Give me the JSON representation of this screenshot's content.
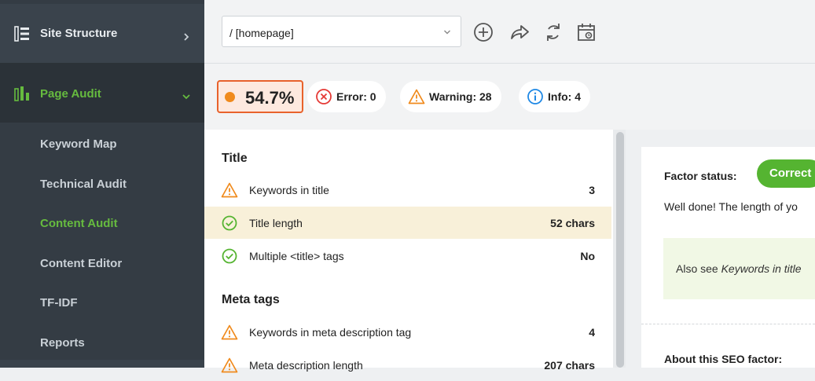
{
  "sidebar": {
    "site_structure": "Site Structure",
    "page_audit": "Page Audit",
    "items": [
      {
        "label": "Keyword Map"
      },
      {
        "label": "Technical Audit"
      },
      {
        "label": "Content Audit",
        "active": true
      },
      {
        "label": "Content Editor"
      },
      {
        "label": "TF-IDF"
      },
      {
        "label": "Reports"
      }
    ]
  },
  "toolbar": {
    "url_value": "/ [homepage]",
    "icons": [
      "add-circle-icon",
      "share-icon",
      "refresh-icon",
      "calendar-schedule-icon"
    ]
  },
  "status": {
    "score": "54.7%",
    "error": "Error: 0",
    "warning": "Warning: 28",
    "info": "Info: 4"
  },
  "factors": {
    "title_section": "Title",
    "meta_section": "Meta tags",
    "rows": [
      {
        "label": "Keywords in title",
        "value": "3",
        "status": "warning"
      },
      {
        "label": "Title length",
        "value": "52 chars",
        "status": "correct",
        "selected": true
      },
      {
        "label": "Multiple <title> tags",
        "value": "No",
        "status": "correct"
      },
      {
        "label": "Keywords in meta description tag",
        "value": "4",
        "status": "warning"
      },
      {
        "label": "Meta description length",
        "value": "207 chars",
        "status": "warning"
      }
    ]
  },
  "detail": {
    "factor_status_label": "Factor status:",
    "status_badge": "Correct",
    "message": "Well done! The length of yo",
    "see_also_prefix": "Also see ",
    "see_also_link": "Keywords in title",
    "about_label": "About this SEO factor:"
  },
  "colors": {
    "accent_green": "#66bb3f",
    "score_orange": "#e8622c",
    "error_red": "#e53935",
    "warning_orange": "#f08a1c",
    "info_blue": "#1e88e5",
    "correct_green": "#55b431"
  }
}
